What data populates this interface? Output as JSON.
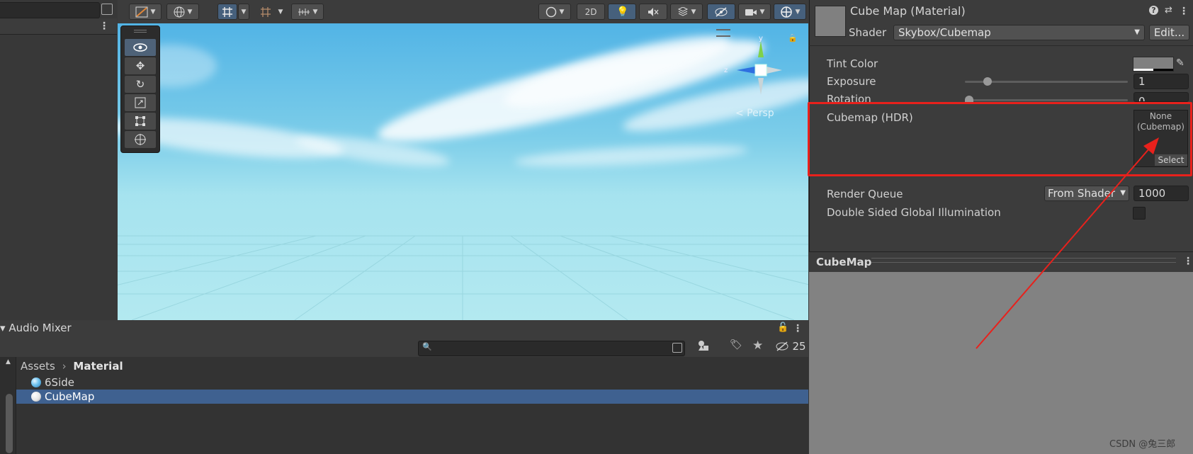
{
  "scene_toolbar": {
    "two_d_label": "2D"
  },
  "scene_view": {
    "axis_y": "y",
    "axis_z": "z",
    "persp_label": "< Persp"
  },
  "audio_mixer": {
    "tab_label": "Audio Mixer",
    "hidden_count": "25"
  },
  "project": {
    "breadcrumb": [
      "Assets",
      "Material"
    ],
    "items": [
      {
        "label": "6Side",
        "selected": false
      },
      {
        "label": "CubeMap",
        "selected": true
      }
    ]
  },
  "inspector": {
    "material_title": "Cube Map (Material)",
    "help_icon": "?",
    "shader_label": "Shader",
    "shader_value": "Skybox/Cubemap",
    "edit_label": "Edit...",
    "properties": {
      "tint_color_label": "Tint Color",
      "exposure_label": "Exposure",
      "exposure_value": "1",
      "exposure_fraction": 0.14,
      "rotation_label": "Rotation",
      "rotation_value": "0",
      "rotation_fraction": 0.0,
      "cubemap_label": "Cubemap   (HDR)",
      "cubemap_slot_line1": "None",
      "cubemap_slot_line2": "(Cubemap)",
      "cubemap_select": "Select",
      "render_queue_label": "Render Queue",
      "render_queue_mode": "From Shader",
      "render_queue_value": "1000",
      "double_sided_gi_label": "Double Sided Global Illumination"
    },
    "preview_title": "CubeMap"
  },
  "annotation": {
    "highlight_color": "#e8211c"
  },
  "watermark": "CSDN @兔三郎",
  "colors": {
    "panel_bg": "#383838",
    "selection": "#3f6190",
    "toggle_on": "#46607c"
  },
  "icons": [
    "search-icon",
    "expand-icon",
    "kebab-icon",
    "eye-icon",
    "move-icon",
    "rotate-icon",
    "scale-icon",
    "rect-tool-icon",
    "transform-icon",
    "lock-icon",
    "eyedropper-icon",
    "settings-icon",
    "help-icon",
    "star-icon",
    "label-tag-icon",
    "filter-type-icon",
    "visibility-icon",
    "light-icon",
    "audio-mute-icon",
    "fx-icon",
    "camera-icon",
    "gizmo-icon",
    "grid-snap-icon",
    "globe-icon"
  ]
}
